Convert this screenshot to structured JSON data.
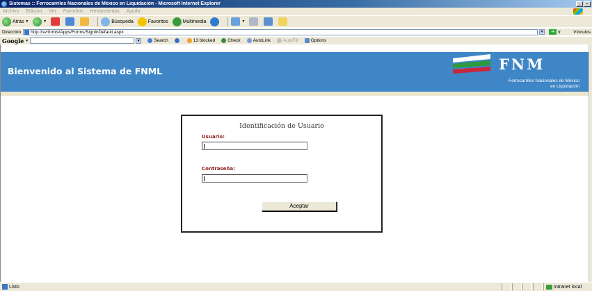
{
  "window": {
    "title": "Sistemas :: Ferrocarriles Nacionales de México en Liquidación - Microsoft Internet Explorer"
  },
  "menubar": {
    "items": [
      "Archivo",
      "Edición",
      "Ver",
      "Favoritos",
      "Herramientas",
      "Ayuda"
    ]
  },
  "toolbar": {
    "back": "Atrás",
    "search": "Búsqueda",
    "favorites": "Favoritos",
    "multimedia": "Multimedia"
  },
  "addressbar": {
    "label": "Dirección",
    "url": "http://svrfnmls/Apps/Forms/SignInDefault.aspx",
    "go": "Ir",
    "links": "Vínculos"
  },
  "googlebar": {
    "logo": "Google",
    "search": "Search",
    "blocked": "13 blocked",
    "check": "Check",
    "autolink": "AutoLink",
    "autofill": "AutoFill",
    "options": "Options"
  },
  "page": {
    "banner_title": "Bienvenido al Sistema de FNML",
    "logo_text": "FNM",
    "logo_sub1": "Ferrocarriles Nacionales de México",
    "logo_sub2": "en Liquidación",
    "login": {
      "title": "Identificación de Usuario",
      "user_label": "Usuario:",
      "user_value": "",
      "pass_label": "Contraseña:",
      "pass_value": "",
      "submit": "Aceptar"
    }
  },
  "statusbar": {
    "text": "Listo",
    "zone": "Intranet local"
  },
  "colors": {
    "banner": "#3e86c6",
    "label_red": "#8b1a1a",
    "chrome": "#ece9d8"
  }
}
